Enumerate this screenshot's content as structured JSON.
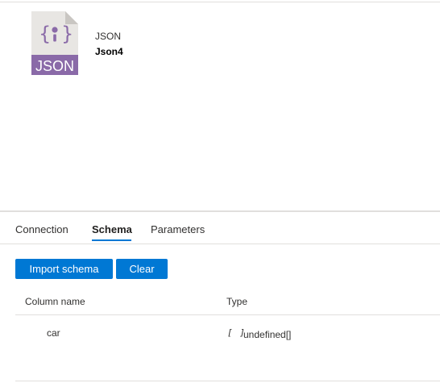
{
  "dataset": {
    "type_label": "JSON",
    "name": "Json4",
    "icon_text": "JSON",
    "icon_colors": {
      "page": "#e8e6e3",
      "fold": "#c9c6c2",
      "accent": "#8a6aa8"
    }
  },
  "tabs": [
    {
      "label": "Connection",
      "active": false
    },
    {
      "label": "Schema",
      "active": true
    },
    {
      "label": "Parameters",
      "active": false
    }
  ],
  "toolbar": {
    "import_schema_label": "Import schema",
    "clear_label": "Clear"
  },
  "schema_table": {
    "columns": [
      "Column name",
      "Type"
    ],
    "rows": [
      {
        "name": "car",
        "type_icon": "[ ]",
        "type": "undefined[]"
      }
    ]
  },
  "colors": {
    "accent": "#0078d4",
    "border": "#e1dfdd",
    "text": "#323130"
  }
}
